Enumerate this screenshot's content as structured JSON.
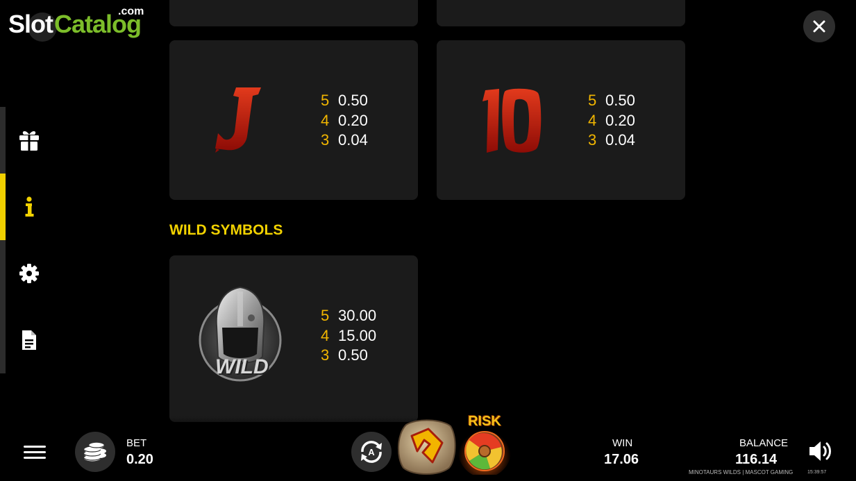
{
  "logo": {
    "slot": "Slot",
    "catalog": "Catalog",
    "com": ".com"
  },
  "sidebar": {
    "items": [
      {
        "icon": "gift-icon"
      },
      {
        "icon": "info-icon",
        "active": true
      },
      {
        "icon": "gear-icon"
      },
      {
        "icon": "document-icon"
      }
    ]
  },
  "paytable": {
    "cards": [
      {
        "symbol": "J",
        "pays": [
          {
            "count": "5",
            "value": "0.50"
          },
          {
            "count": "4",
            "value": "0.20"
          },
          {
            "count": "3",
            "value": "0.04"
          }
        ]
      },
      {
        "symbol": "10",
        "pays": [
          {
            "count": "5",
            "value": "0.50"
          },
          {
            "count": "4",
            "value": "0.20"
          },
          {
            "count": "3",
            "value": "0.04"
          }
        ]
      }
    ],
    "wild_title": "WILD SYMBOLS",
    "wild": {
      "symbol": "WILD",
      "pays": [
        {
          "count": "5",
          "value": "30.00"
        },
        {
          "count": "4",
          "value": "15.00"
        },
        {
          "count": "3",
          "value": "0.50"
        }
      ]
    }
  },
  "bottom_bar": {
    "bet_label": "BET",
    "bet_value": "0.20",
    "win_label": "WIN",
    "win_value": "17.06",
    "balance_label": "BALANCE",
    "balance_value": "116.14",
    "risk_label": "RISK",
    "credits": "MINOTAURS WILDS | MASCOT GAMING",
    "clock": "15:39:57"
  },
  "colors": {
    "accent": "#f2d200",
    "pay_count": "#f2b600",
    "card_bg": "#1b1b1b",
    "logo_green": "#7cbd2a"
  }
}
